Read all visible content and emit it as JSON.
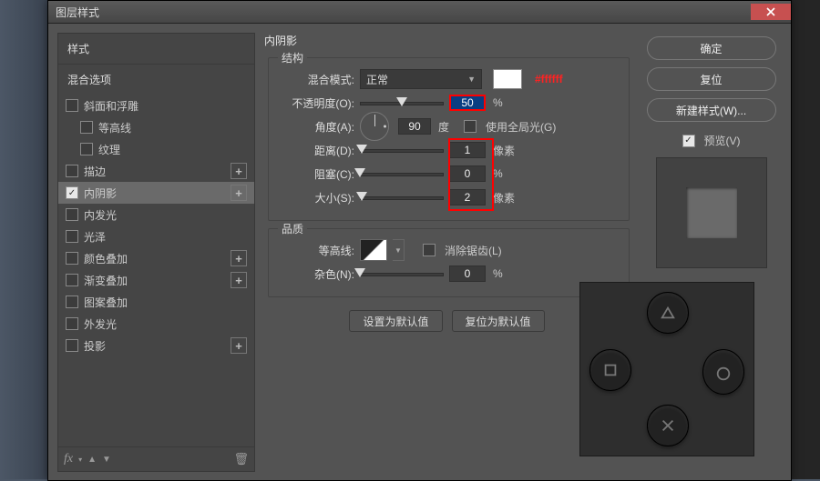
{
  "window_title": "图层样式",
  "sidebar": {
    "header1": "样式",
    "header2": "混合选项",
    "items": [
      {
        "label": "斜面和浮雕",
        "checked": false,
        "has_add": false,
        "sub": false
      },
      {
        "label": "等高线",
        "checked": false,
        "has_add": false,
        "sub": true
      },
      {
        "label": "纹理",
        "checked": false,
        "has_add": false,
        "sub": true
      },
      {
        "label": "描边",
        "checked": false,
        "has_add": true,
        "sub": false
      },
      {
        "label": "内阴影",
        "checked": true,
        "has_add": true,
        "sub": false,
        "selected": true
      },
      {
        "label": "内发光",
        "checked": false,
        "has_add": false,
        "sub": false
      },
      {
        "label": "光泽",
        "checked": false,
        "has_add": false,
        "sub": false
      },
      {
        "label": "颜色叠加",
        "checked": false,
        "has_add": true,
        "sub": false
      },
      {
        "label": "渐变叠加",
        "checked": false,
        "has_add": true,
        "sub": false
      },
      {
        "label": "图案叠加",
        "checked": false,
        "has_add": false,
        "sub": false
      },
      {
        "label": "外发光",
        "checked": false,
        "has_add": false,
        "sub": false
      },
      {
        "label": "投影",
        "checked": false,
        "has_add": true,
        "sub": false
      }
    ]
  },
  "main": {
    "title": "内阴影",
    "structure": {
      "legend": "结构",
      "blend_mode_label": "混合模式:",
      "blend_mode_value": "正常",
      "color": "#ffffff",
      "hex_annotation": "#ffffff",
      "opacity_label": "不透明度(O):",
      "opacity_value": "50",
      "opacity_unit": "%",
      "angle_label": "角度(A):",
      "angle_value": "90",
      "angle_unit": "度",
      "global_light_label": "使用全局光(G)",
      "distance_label": "距离(D):",
      "distance_value": "1",
      "distance_unit": "像素",
      "choke_label": "阻塞(C):",
      "choke_value": "0",
      "choke_unit": "%",
      "size_label": "大小(S):",
      "size_value": "2",
      "size_unit": "像素"
    },
    "quality": {
      "legend": "品质",
      "contour_label": "等高线:",
      "antialias_label": "消除锯齿(L)",
      "noise_label": "杂色(N):",
      "noise_value": "0",
      "noise_unit": "%"
    },
    "btn_default": "设置为默认值",
    "btn_reset": "复位为默认值"
  },
  "right": {
    "ok": "确定",
    "cancel": "复位",
    "new_style": "新建样式(W)...",
    "preview_label": "预览(V)"
  }
}
